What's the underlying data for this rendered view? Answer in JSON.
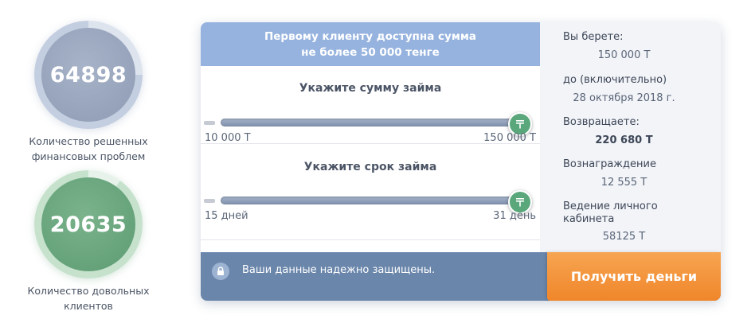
{
  "stats": [
    {
      "value": "64898",
      "label_line1": "Количество решенных",
      "label_line2": "финансовых проблем"
    },
    {
      "value": "20635",
      "label_line1": "Количество довольных",
      "label_line2": "клиентов"
    }
  ],
  "banner": {
    "line1": "Первому клиенту доступна сумма",
    "line2": "не более 50 000 тенге"
  },
  "amount": {
    "title": "Укажите сумму займа",
    "min_label": "10 000 Т",
    "max_label": "150 000 Т",
    "fill_fraction": 1.0
  },
  "term": {
    "title": "Укажите срок займа",
    "min_label": "15 дней",
    "max_label": "31 день",
    "fill_fraction": 1.0
  },
  "summary": {
    "take_label": "Вы берете:",
    "take_value": "150 000 Т",
    "until_label": "до (включительно)",
    "until_value": "28 октября 2018 г.",
    "return_label": "Возвращаете:",
    "return_value": "220 680 Т",
    "reward_label": "Вознаграждение",
    "reward_value": "12 555 Т",
    "cabinet_label_line1": "Ведение личного",
    "cabinet_label_line2": "кабинета",
    "cabinet_value": "58125 Т"
  },
  "footer": {
    "secure_text": "Ваши данные надежно защищены.",
    "cta_label": "Получить деньги"
  },
  "icons": {
    "slider_thumb": "tenge-icon",
    "secure": "lock-icon"
  },
  "colors": {
    "accent_orange": "#f0862a",
    "thumb_green": "#5aa77c",
    "banner_blue": "#96b3df",
    "footer_blue": "#6a86ab"
  }
}
